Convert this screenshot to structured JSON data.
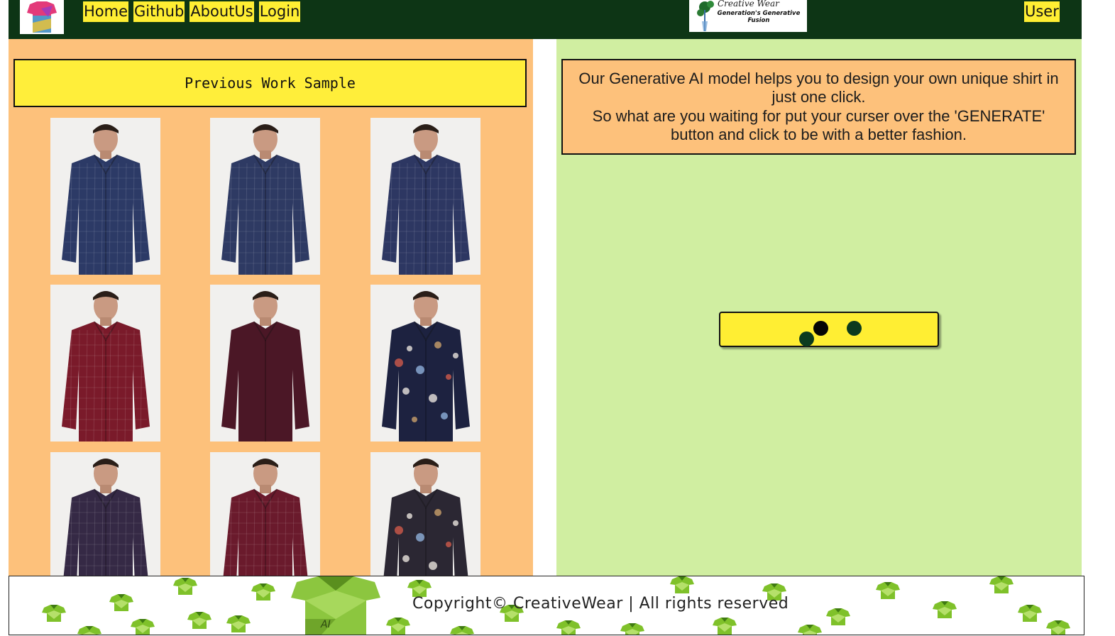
{
  "nav": {
    "links": [
      "Home",
      "Github",
      "AboutUs",
      "Login"
    ],
    "user_label": "User",
    "logo_icon": "tshirt-logo-icon",
    "brand": {
      "script": "Creative Wear",
      "tagline": "Generation's Generative Fusion"
    }
  },
  "left": {
    "title": "Previous Work Sample",
    "samples": [
      {
        "shirt": "#2c3a66",
        "pattern": "plaid"
      },
      {
        "shirt": "#2e3a63",
        "pattern": "plaid"
      },
      {
        "shirt": "#2d3762",
        "pattern": "plaid"
      },
      {
        "shirt": "#7a1a2a",
        "pattern": "plaid"
      },
      {
        "shirt": "#4b1726",
        "pattern": "plain"
      },
      {
        "shirt": "#1d2240",
        "pattern": "floral"
      },
      {
        "shirt": "#352945",
        "pattern": "plaid"
      },
      {
        "shirt": "#6a1a2c",
        "pattern": "plaid"
      },
      {
        "shirt": "#2b2733",
        "pattern": "floral"
      }
    ]
  },
  "right": {
    "intro": [
      "Our Generative AI model helps you to design your own unique shirt in just one click.",
      "So what are you waiting for put your curser over the 'GENERATE' button and click to be with a better fashion."
    ],
    "generate_state": "loading"
  },
  "footer": {
    "copyright": "Copyright© CreativeWear | All rights reserved"
  },
  "colors": {
    "navbar": "#0d3515",
    "accent_yellow": "#ffee33",
    "left_panel": "#fdc17b",
    "right_panel": "#d0eea1",
    "dot_dark": "#0b3a1e",
    "footer_pattern": "#7fc12a"
  }
}
